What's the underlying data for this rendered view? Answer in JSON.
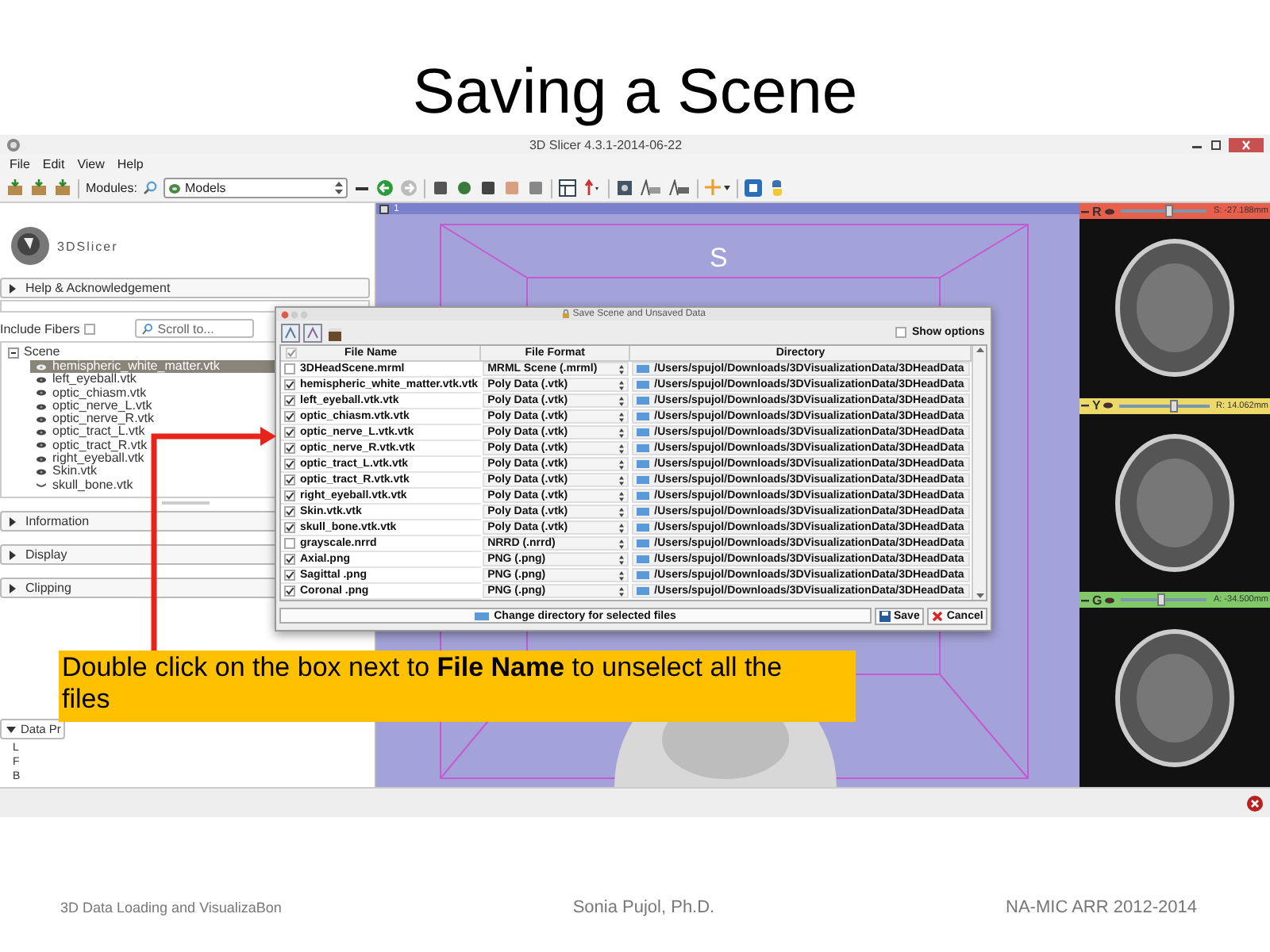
{
  "slide": {
    "title": "Saving a Scene"
  },
  "window": {
    "title": "3D Slicer 4.3.1-2014-06-22"
  },
  "menu": [
    {
      "label": "File"
    },
    {
      "label": "Edit"
    },
    {
      "label": "View"
    },
    {
      "label": "Help"
    }
  ],
  "toolbar": {
    "modules_label": "Modules:",
    "module": "Models"
  },
  "module_panel": {
    "logo_text": "3DSlicer",
    "top_sections": [
      {
        "label": "Help & Acknowledgement",
        "expanded": false
      }
    ],
    "include_fibers": {
      "label": "Include Fibers",
      "checked": false
    },
    "scroll_to": {
      "placeholder": "Scroll to..."
    },
    "tree": {
      "root": "Scene",
      "expanded": true,
      "children": [
        {
          "name": "hemispheric_white_matter.vtk",
          "visible": true,
          "selected": true
        },
        {
          "name": "left_eyeball.vtk",
          "visible": true,
          "selected": false
        },
        {
          "name": "optic_chiasm.vtk",
          "visible": true,
          "selected": false
        },
        {
          "name": "optic_nerve_L.vtk",
          "visible": true,
          "selected": false
        },
        {
          "name": "optic_nerve_R.vtk",
          "visible": true,
          "selected": false
        },
        {
          "name": "optic_tract_L.vtk",
          "visible": true,
          "selected": false
        },
        {
          "name": "optic_tract_R.vtk",
          "visible": true,
          "selected": false
        },
        {
          "name": "right_eyeball.vtk",
          "visible": true,
          "selected": false
        },
        {
          "name": "Skin.vtk",
          "visible": true,
          "selected": false
        },
        {
          "name": "skull_bone.vtk",
          "visible": false,
          "selected": false
        }
      ]
    },
    "sections": [
      {
        "label": "Information",
        "expanded": false
      },
      {
        "label": "Display",
        "expanded": false
      },
      {
        "label": "Clipping",
        "expanded": false
      }
    ],
    "data_probe": {
      "label": "Data Pr",
      "expanded": true,
      "lines": [
        "L",
        "F",
        "B"
      ]
    }
  },
  "view_3d": {
    "view_label": "1",
    "orientation": "S"
  },
  "slice_views": [
    {
      "letter": "R",
      "color": "#e8604c",
      "level": 0.55,
      "offset": "S: -27.188mm"
    },
    {
      "letter": "Y",
      "color": "#ecd96a",
      "level": 0.6,
      "offset": "R: 14.062mm"
    },
    {
      "letter": "G",
      "color": "#80c868",
      "level": 0.45,
      "offset": "A: -34.500mm"
    }
  ],
  "dialog": {
    "title": "Save Scene and Unsaved Data",
    "show_options": {
      "label": "Show options",
      "checked": false
    },
    "select_all_checked": true,
    "columns": [
      "File Name",
      "File Format",
      "Directory"
    ],
    "rows": [
      {
        "file": "3DHeadScene.mrml",
        "checked": false,
        "format": "MRML Scene (.mrml)",
        "directory": "/Users/spujol/Downloads/3DVisualizationData/3DHeadData"
      },
      {
        "file": "hemispheric_white_matter.vtk.vtk",
        "checked": true,
        "format": "Poly Data (.vtk)",
        "directory": "/Users/spujol/Downloads/3DVisualizationData/3DHeadData"
      },
      {
        "file": "left_eyeball.vtk.vtk",
        "checked": true,
        "format": "Poly Data (.vtk)",
        "directory": "/Users/spujol/Downloads/3DVisualizationData/3DHeadData"
      },
      {
        "file": "optic_chiasm.vtk.vtk",
        "checked": true,
        "format": "Poly Data (.vtk)",
        "directory": "/Users/spujol/Downloads/3DVisualizationData/3DHeadData"
      },
      {
        "file": "optic_nerve_L.vtk.vtk",
        "checked": true,
        "format": "Poly Data (.vtk)",
        "directory": "/Users/spujol/Downloads/3DVisualizationData/3DHeadData"
      },
      {
        "file": "optic_nerve_R.vtk.vtk",
        "checked": true,
        "format": "Poly Data (.vtk)",
        "directory": "/Users/spujol/Downloads/3DVisualizationData/3DHeadData"
      },
      {
        "file": "optic_tract_L.vtk.vtk",
        "checked": true,
        "format": "Poly Data (.vtk)",
        "directory": "/Users/spujol/Downloads/3DVisualizationData/3DHeadData"
      },
      {
        "file": "optic_tract_R.vtk.vtk",
        "checked": true,
        "format": "Poly Data (.vtk)",
        "directory": "/Users/spujol/Downloads/3DVisualizationData/3DHeadData"
      },
      {
        "file": "right_eyeball.vtk.vtk",
        "checked": true,
        "format": "Poly Data (.vtk)",
        "directory": "/Users/spujol/Downloads/3DVisualizationData/3DHeadData"
      },
      {
        "file": "Skin.vtk.vtk",
        "checked": true,
        "format": "Poly Data (.vtk)",
        "directory": "/Users/spujol/Downloads/3DVisualizationData/3DHeadData"
      },
      {
        "file": "skull_bone.vtk.vtk",
        "checked": true,
        "format": "Poly Data (.vtk)",
        "directory": "/Users/spujol/Downloads/3DVisualizationData/3DHeadData"
      },
      {
        "file": "grayscale.nrrd",
        "checked": false,
        "format": "NRRD (.nrrd)",
        "directory": "/Users/spujol/Downloads/3DVisualizationData/3DHeadData"
      },
      {
        "file": "Axial.png",
        "checked": true,
        "format": "PNG (.png)",
        "directory": "/Users/spujol/Downloads/3DVisualizationData/3DHeadData"
      },
      {
        "file": "Sagittal .png",
        "checked": true,
        "format": "PNG (.png)",
        "directory": "/Users/spujol/Downloads/3DVisualizationData/3DHeadData"
      },
      {
        "file": "Coronal .png",
        "checked": true,
        "format": "PNG (.png)",
        "directory": "/Users/spujol/Downloads/3DVisualizationData/3DHeadData"
      }
    ],
    "change_directory": "Change directory for selected files",
    "buttons": [
      {
        "kind": "save",
        "label": "Save"
      },
      {
        "kind": "cancel",
        "label": "Cancel"
      }
    ]
  },
  "callout": {
    "text": "Double click on the box next to **File Name** to unselect all the files"
  },
  "footer": {
    "left": "3D Data Loading and VisualizaBon",
    "center": "Sonia Pujol, Ph.D.",
    "right": "NA-MIC ARR 2012-2014"
  }
}
